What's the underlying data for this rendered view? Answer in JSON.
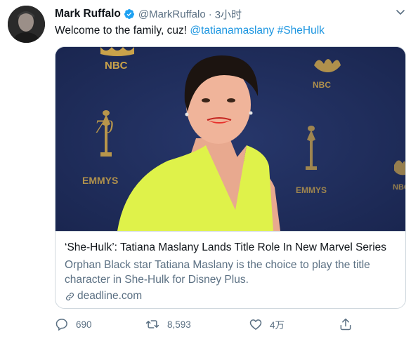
{
  "author": {
    "name": "Mark Ruffalo",
    "handle": "@MarkRuffalo",
    "separator": "·",
    "time": "3小时"
  },
  "tweet": {
    "text_plain": "Welcome to the family, cuz! ",
    "mention": "@tatianamaslany",
    "hashtag": "#SheHulk"
  },
  "card": {
    "title": "‘She-Hulk’: Tatiana Maslany Lands Title Role In New Marvel Series",
    "description": "Orphan Black star Tatiana Maslany is the choice to play the title character in She-Hulk for Disney Plus.",
    "domain": "deadline.com",
    "image_texts": {
      "nbc_1": "NBC",
      "nbc_2": "NBC",
      "nbc_3": "NBC",
      "emmys_1": "EMMYS",
      "emmys_2": "EMMYS",
      "seventy": "70"
    }
  },
  "actions": {
    "reply_count": "690",
    "retweet_count": "8,593",
    "like_count": "4万"
  },
  "colors": {
    "link": "#1b95e0",
    "secondary": "#5b7083",
    "verified": "#1da1f2",
    "backdrop": "#1f2d58"
  },
  "icons": [
    "verified-badge-icon",
    "chevron-down-icon",
    "link-icon",
    "reply-icon",
    "retweet-icon",
    "like-icon",
    "share-icon"
  ]
}
